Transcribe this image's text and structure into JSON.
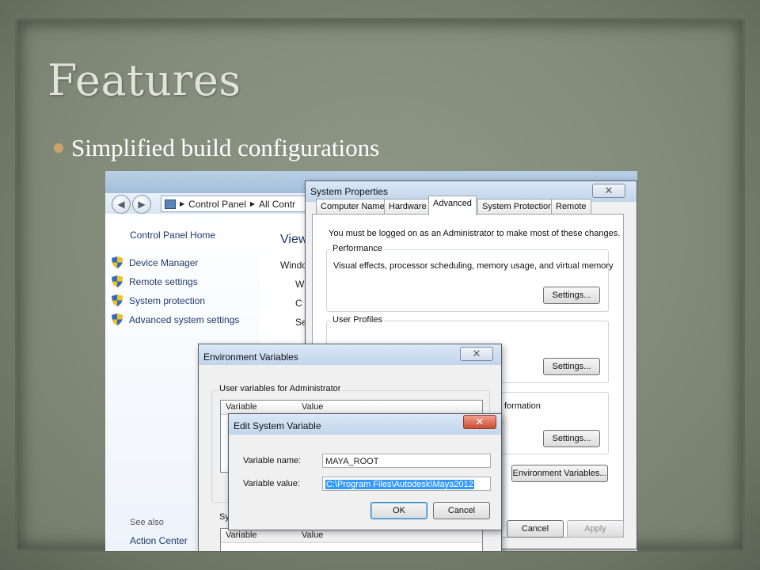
{
  "slide": {
    "title": "Features",
    "bullet": "Simplified build configurations"
  },
  "explorer": {
    "address": [
      "Control Panel",
      "All Contr"
    ],
    "left_pane": {
      "home": "Control Panel Home",
      "items": [
        "Device Manager",
        "Remote settings",
        "System protection",
        "Advanced system settings"
      ],
      "see_also": "See also",
      "action_center": "Action Center"
    },
    "main_pane": {
      "view": "View",
      "windows": "Windo",
      "w": "W",
      "c": "C",
      "se": "Se"
    }
  },
  "system_properties": {
    "title": "System Properties",
    "close": "✕",
    "tabs": [
      "Computer Name",
      "Hardware",
      "Advanced",
      "System Protection",
      "Remote"
    ],
    "active_tab": "Advanced",
    "admin_note": "You must be logged on as an Administrator to make most of these changes.",
    "performance": {
      "label": "Performance",
      "desc": "Visual effects, processor scheduling, memory usage, and virtual memory",
      "button": "Settings..."
    },
    "user_profiles": {
      "label": "User Profiles",
      "button": "Settings..."
    },
    "startup": {
      "fragment": "formation",
      "button": "Settings..."
    },
    "env_button": "Environment Variables...",
    "cancel": "Cancel",
    "apply": "Apply"
  },
  "environment_variables": {
    "title": "Environment Variables",
    "close": "✕",
    "user_group": "User variables for Administrator",
    "system_group": "Sy",
    "col_variable": "Variable",
    "col_value": "Value"
  },
  "edit_system_variable": {
    "title": "Edit System Variable",
    "close": "✕",
    "name_label": "Variable name:",
    "name_value": "MAYA_ROOT",
    "value_label": "Variable value:",
    "value_value": "C:\\Program Files\\Autodesk\\Maya2012",
    "ok": "OK",
    "cancel": "Cancel"
  }
}
